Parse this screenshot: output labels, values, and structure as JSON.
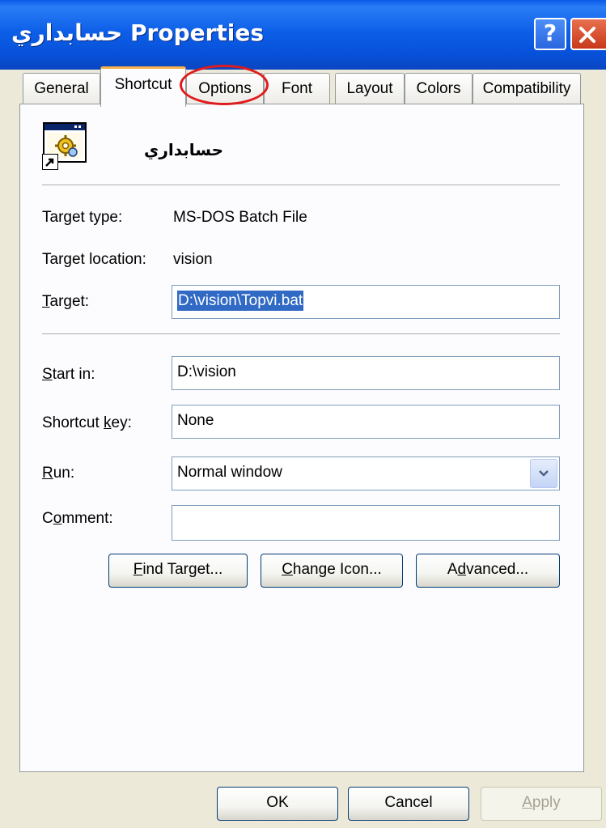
{
  "window": {
    "title_rtl": "حسابداري",
    "title_suffix": "Properties",
    "help_button": "?"
  },
  "tabs": [
    {
      "label": "General"
    },
    {
      "label": "Shortcut"
    },
    {
      "label": "Options"
    },
    {
      "label": "Font"
    },
    {
      "label": "Layout"
    },
    {
      "label": "Colors"
    },
    {
      "label": "Compatibility"
    }
  ],
  "active_tab": "Shortcut",
  "shortcut": {
    "name": "حسابداري",
    "target_type_label": "Target type:",
    "target_type_value": "MS-DOS Batch File",
    "target_location_label": "Target location:",
    "target_location_value": "vision",
    "target_label": {
      "mnemonic": "T",
      "rest": "arget:"
    },
    "target_value": "D:\\vision\\Topvi.bat",
    "start_in_label": {
      "mnemonic": "S",
      "rest": "tart in:"
    },
    "start_in_value": "D:\\vision",
    "shortcut_key_label": {
      "pre": "Shortcut ",
      "mnemonic": "k",
      "rest": "ey:"
    },
    "shortcut_key_value": "None",
    "run_label": {
      "mnemonic": "R",
      "rest": "un:"
    },
    "run_value": "Normal window",
    "comment_label": {
      "pre": "C",
      "mnemonic": "o",
      "rest": "mment:"
    },
    "comment_value": ""
  },
  "buttons": {
    "find_target": {
      "mnemonic": "F",
      "rest": "ind Target..."
    },
    "change_icon": {
      "mnemonic": "C",
      "rest": "hange Icon..."
    },
    "advanced": {
      "pre": "A",
      "mnemonic": "d",
      "rest": "vanced..."
    },
    "ok": "OK",
    "cancel": "Cancel",
    "apply": {
      "mnemonic": "A",
      "rest": "pply"
    }
  },
  "colors": {
    "titlebar": "#0a5ae8",
    "active_tab_accent": "#f7b14a",
    "selection": "#316ac5",
    "annotation_circle": "#e01b1b"
  },
  "icons": {
    "app_icon": "batch-file-gear-icon",
    "shortcut_overlay": "shortcut-arrow-icon",
    "dropdown": "chevron-down-icon",
    "close": "close-icon"
  }
}
